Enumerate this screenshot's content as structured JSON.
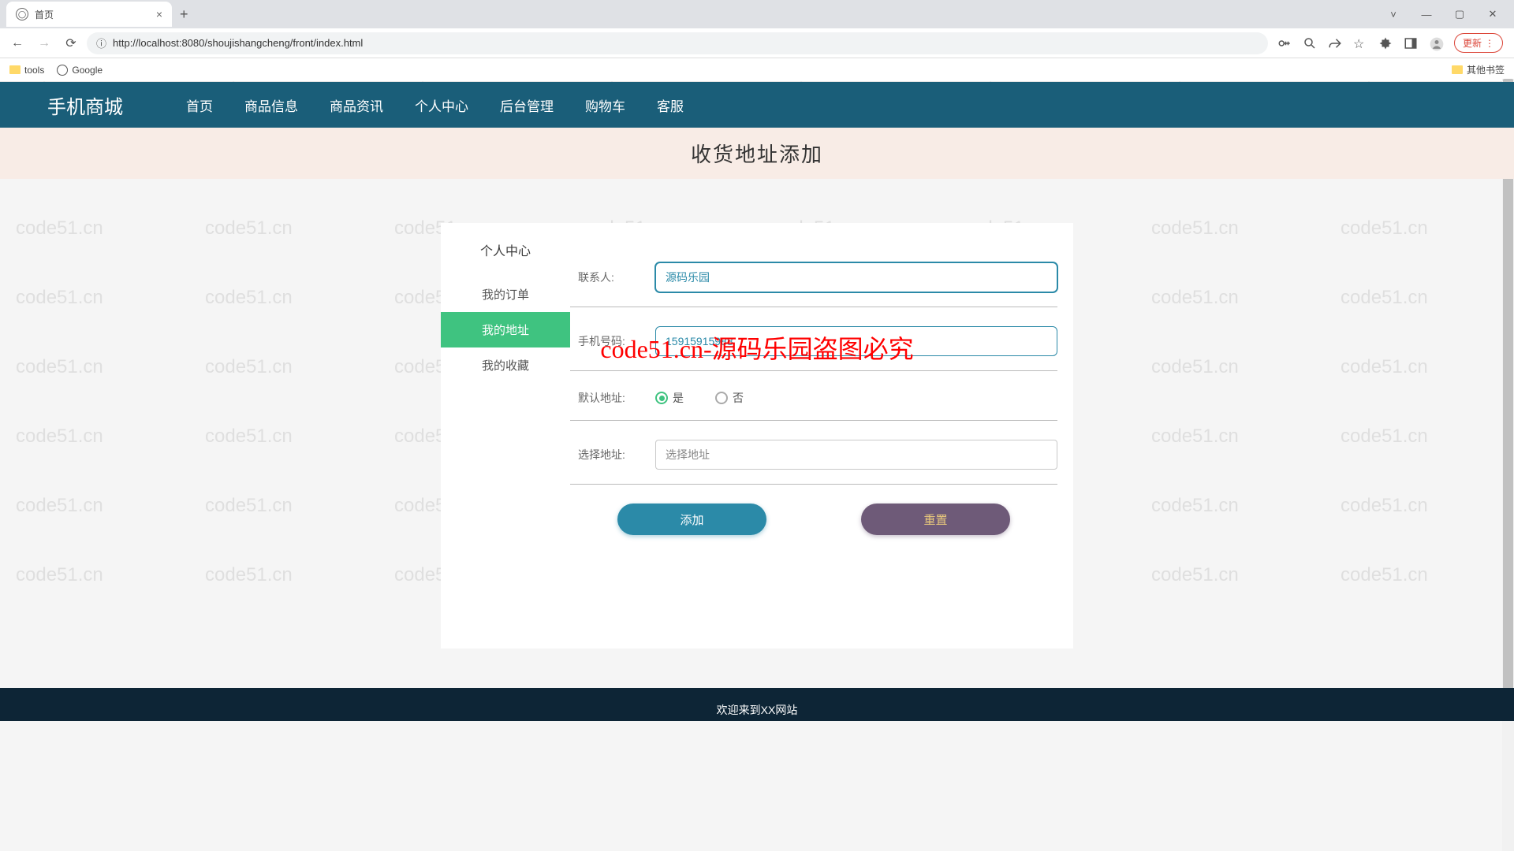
{
  "browser": {
    "tab_title": "首页",
    "url": "http://localhost:8080/shoujishangcheng/front/index.html",
    "update_label": "更新"
  },
  "bookmarks": {
    "tools": "tools",
    "google": "Google",
    "other": "其他书签"
  },
  "watermark": "code51.cn",
  "watermark_overlay": "code51.cn-源码乐园盗图必究",
  "nav": {
    "logo": "手机商城",
    "items": [
      "首页",
      "商品信息",
      "商品资讯",
      "个人中心",
      "后台管理",
      "购物车",
      "客服"
    ]
  },
  "page_title": "收货地址添加",
  "sidebar": {
    "title": "个人中心",
    "items": [
      {
        "label": "我的订单",
        "active": false
      },
      {
        "label": "我的地址",
        "active": true
      },
      {
        "label": "我的收藏",
        "active": false
      }
    ]
  },
  "form": {
    "contact": {
      "label": "联系人:",
      "value": "源码乐园"
    },
    "phone": {
      "label": "手机号码:",
      "value": "15915915988"
    },
    "default_addr": {
      "label": "默认地址:",
      "yes": "是",
      "no": "否"
    },
    "select_addr": {
      "label": "选择地址:",
      "placeholder": "选择地址"
    },
    "add_btn": "添加",
    "reset_btn": "重置"
  },
  "footer": "欢迎来到XX网站"
}
